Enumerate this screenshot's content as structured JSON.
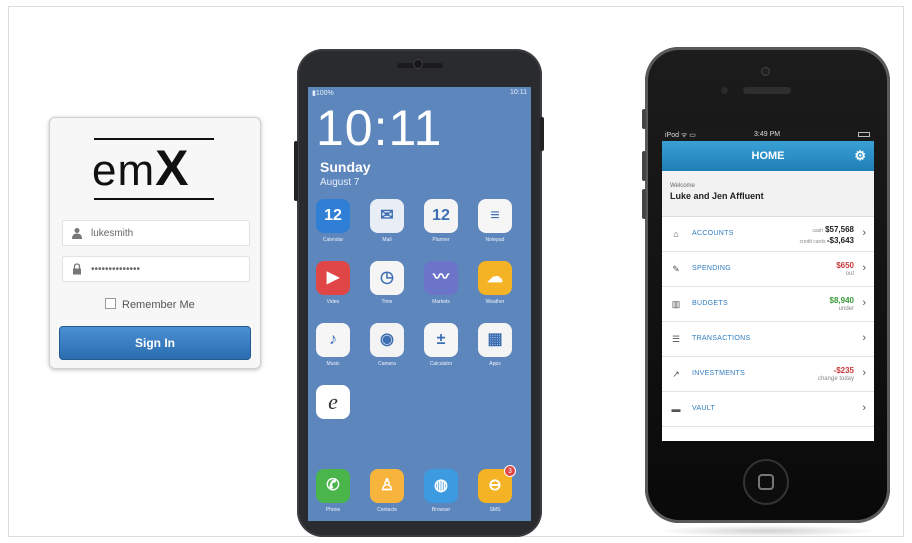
{
  "login": {
    "logo_text": "em",
    "logo_x": "X",
    "username": "lukesmith",
    "password": "••••••••••••••",
    "remember_label": "Remember Me",
    "signin_label": "Sign In"
  },
  "android": {
    "status_left": "▮100%",
    "status_right": "10:11",
    "clock": "10:11",
    "day": "Sunday",
    "date": "August 7",
    "apps": [
      {
        "label": "Calendar",
        "glyph": "12",
        "icon": "calendar-icon",
        "color": "#2f7fd6"
      },
      {
        "label": "Mail",
        "glyph": "✉",
        "icon": "mail-icon",
        "color": "#e9eef6"
      },
      {
        "label": "Planner",
        "glyph": "12",
        "icon": "planner-icon",
        "color": "#f4f4f4"
      },
      {
        "label": "Notepad",
        "glyph": "≡",
        "icon": "notepad-icon",
        "color": "#f6f6f6"
      },
      {
        "label": "Video",
        "glyph": "▶",
        "icon": "video-icon",
        "color": "#e04646"
      },
      {
        "label": "Time",
        "glyph": "◷",
        "icon": "clock-icon",
        "color": "#f5f5f5"
      },
      {
        "label": "Markets",
        "glyph": "〰",
        "icon": "markets-icon",
        "color": "#6c74c9"
      },
      {
        "label": "Weather",
        "glyph": "☁",
        "icon": "weather-icon",
        "color": "#f3b324"
      },
      {
        "label": "Music",
        "glyph": "♪",
        "icon": "music-icon",
        "color": "#f6f6f6"
      },
      {
        "label": "Camera",
        "glyph": "◉",
        "icon": "camera-icon",
        "color": "#f3f3f3"
      },
      {
        "label": "Calculator",
        "glyph": "±",
        "icon": "calculator-icon",
        "color": "#f6f6f6"
      },
      {
        "label": "Apps",
        "glyph": "▦",
        "icon": "apps-icon",
        "color": "#f4f4f4"
      },
      {
        "label": "",
        "glyph": "e",
        "icon": "browser-e-icon",
        "color": "#ffffff"
      }
    ],
    "dock": [
      {
        "label": "Phone",
        "glyph": "✆",
        "icon": "phone-icon",
        "color": "#49b54b"
      },
      {
        "label": "Contacts",
        "glyph": "♙",
        "icon": "contacts-icon",
        "color": "#f6b43c"
      },
      {
        "label": "Browser",
        "glyph": "◍",
        "icon": "globe-icon",
        "color": "#3c9be0"
      },
      {
        "label": "SMS",
        "glyph": "⊖",
        "icon": "sms-icon",
        "color": "#f3b324",
        "badge": "3"
      }
    ]
  },
  "iphone": {
    "status_left": "iPod ᯤ ▭",
    "status_center": "3:49 PM",
    "nav_title": "HOME",
    "welcome_label": "Welcome",
    "welcome_name": "Luke and Jen Affluent",
    "rows": [
      {
        "label": "ACCOUNTS",
        "icon": "bank-icon",
        "glyph": "⌂",
        "v1_prefix": "cash",
        "v1": "$57,568",
        "v1_color": "dark",
        "v2_prefix": "credit cards",
        "v2": "-$3,643"
      },
      {
        "label": "SPENDING",
        "icon": "pencil-icon",
        "glyph": "✎",
        "v1": "$650",
        "v1_color": "red",
        "v2": "out"
      },
      {
        "label": "BUDGETS",
        "icon": "bars-icon",
        "glyph": "▥",
        "v1": "$8,940",
        "v1_color": "green",
        "v2": "under"
      },
      {
        "label": "TRANSACTIONS",
        "icon": "list-icon",
        "glyph": "☰",
        "v1": "",
        "v1_color": "dark",
        "v2": ""
      },
      {
        "label": "INVESTMENTS",
        "icon": "chart-icon",
        "glyph": "↗",
        "v1": "-$235",
        "v1_color": "red",
        "v2": "change today"
      },
      {
        "label": "VAULT",
        "icon": "folder-icon",
        "glyph": "▬",
        "v1": "",
        "v1_color": "dark",
        "v2": ""
      }
    ]
  }
}
